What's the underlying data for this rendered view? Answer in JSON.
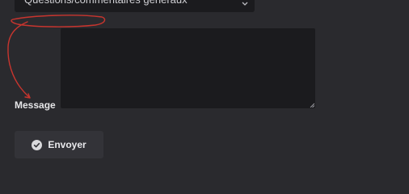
{
  "subject_select": {
    "selected_value": "Questions/commentaires généraux",
    "icon": "chevron-updown-icon"
  },
  "message": {
    "label": "Message",
    "value": ""
  },
  "submit": {
    "label": "Envoyer",
    "icon": "check-circle-icon"
  },
  "annotation": {
    "color": "#c8352e"
  },
  "colors": {
    "background": "#2a2a2e",
    "field": "#1b1b1e",
    "button": "#333338"
  }
}
